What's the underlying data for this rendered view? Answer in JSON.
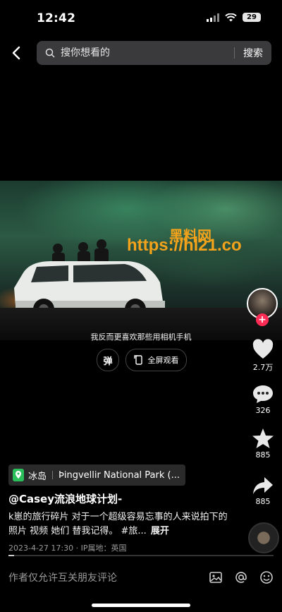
{
  "status_bar": {
    "time": "12:42",
    "battery": "29"
  },
  "search": {
    "placeholder": "搜你想看的",
    "submit_label": "搜索"
  },
  "video": {
    "subtitle": "我反而更喜欢那些用相机手机",
    "watermark_cn": "黑料网",
    "watermark_url": "https://hl21.co",
    "danmu_label": "弹",
    "fullscreen_label": "全屏观看"
  },
  "actions": {
    "like_count": "2.7万",
    "comment_count": "326",
    "favorite_count": "885",
    "share_count": "885"
  },
  "post": {
    "location_country": "冰岛",
    "location_place": "Þingvellir National Park (...",
    "author": "@Casey流浪地球计划-",
    "description": "k崽的旅行碎片 对于一个超级容易忘事的人来说拍下的照片 视频 她们 替我记得。 #旅...",
    "expand_label": "展开",
    "meta": "2023-4-27 17:30 · IP属地：英国",
    "progress": 0.02
  },
  "comment": {
    "placeholder": "作者仅允许互关朋友评论"
  },
  "colors": {
    "accent": "#fe2c55",
    "watermark": "#f2a21b"
  }
}
